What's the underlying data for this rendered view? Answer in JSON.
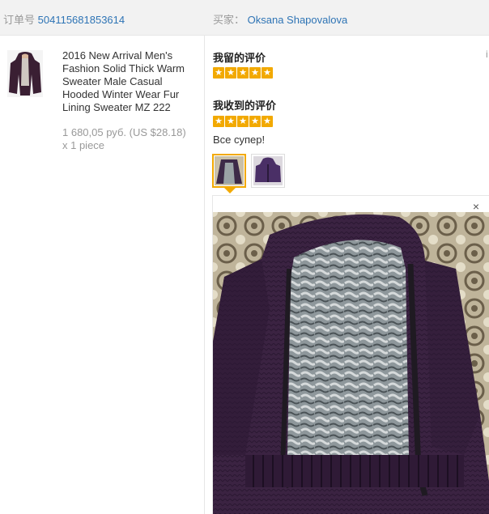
{
  "header": {
    "order_label": "订单号",
    "order_number": "504115681853614",
    "buyer_label": "买家：",
    "buyer_name": "Oksana Shapovalova"
  },
  "product": {
    "title": "2016 New Arrival Men's Fashion Solid Thick Warm Sweater Male Casual Hooded Winter Wear Fur Lining Sweater MZ 222",
    "price": "1 680,05 руб. (US $28.18)",
    "quantity": "x 1 piece"
  },
  "feedback": {
    "left_title": "我留的评价",
    "left_stars": 5,
    "received_title": "我收到的评价",
    "received_stars": 5,
    "comment": "Все супер!",
    "close_symbol": "×"
  },
  "colors": {
    "link": "#2e74b5",
    "star": "#f2a900",
    "header_bg": "#f2f2f2"
  }
}
